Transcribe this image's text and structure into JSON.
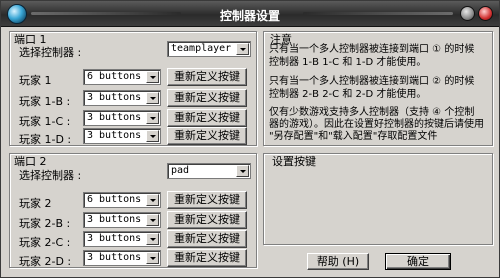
{
  "window": {
    "title": "控制器设置"
  },
  "port1": {
    "title": "端口 1",
    "controller_label": "选择控制器 :",
    "controller_value": "teamplayer",
    "players": [
      {
        "label": "玩家 1",
        "value": "6 buttons",
        "button": "重新定义按键"
      },
      {
        "label": "玩家 1-B :",
        "value": "3 buttons",
        "button": "重新定义按键"
      },
      {
        "label": "玩家 1-C :",
        "value": "3 buttons",
        "button": "重新定义按键"
      },
      {
        "label": "玩家 1-D :",
        "value": "3 buttons",
        "button": "重新定义按键"
      }
    ]
  },
  "port2": {
    "title": "端口 2",
    "controller_label": "选择控制器 :",
    "controller_value": "pad",
    "players": [
      {
        "label": "玩家 2",
        "value": "6 buttons",
        "button": "重新定义按键"
      },
      {
        "label": "玩家 2-B :",
        "value": "3 buttons",
        "button": "重新定义按键"
      },
      {
        "label": "玩家 2-C :",
        "value": "3 buttons",
        "button": "重新定义按键"
      },
      {
        "label": "玩家 2-D :",
        "value": "3 buttons",
        "button": "重新定义按键"
      }
    ]
  },
  "notes": {
    "title": "注意",
    "para1a": "只有当一个多人控制器被连接到端口 ① 的时候",
    "para1b": "控制器 1-B  1-C 和 1-D 才能使用。",
    "para2a": "只有当一个多人控制器被连接到端口 ② 的时候",
    "para2b": "控制器 2-B  2-C 和 2-D 才能使用。",
    "para3a": "仅有少数游戏支持多人控制器（支持 ④ 个控制",
    "para3b": "器的游戏）。因此在设置好控制器的按键后请使用",
    "para3c": "\"另存配置\"和\"载入配置\"存取配置文件"
  },
  "keys": {
    "title": "设置按键"
  },
  "footer": {
    "help": "帮助 (H)",
    "ok": "确定"
  }
}
